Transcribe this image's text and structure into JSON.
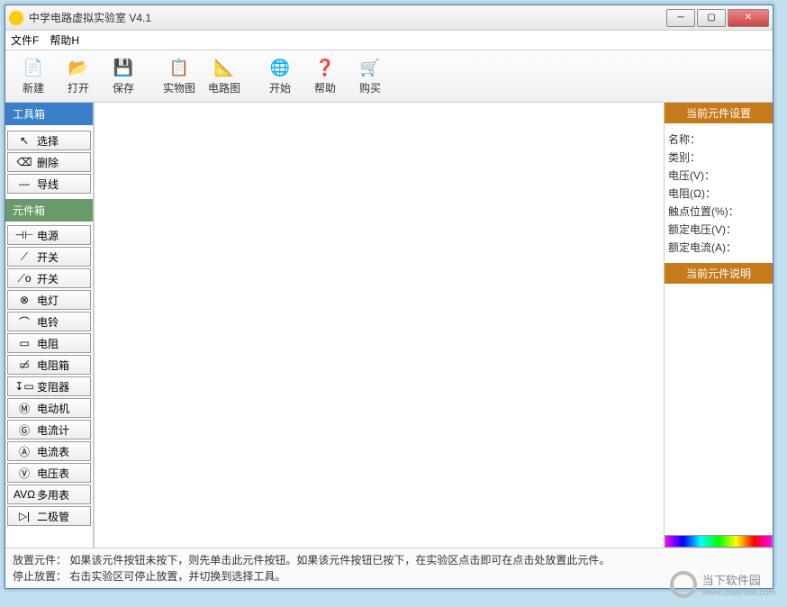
{
  "window": {
    "title": "中学电路虚拟实验室 V4.1"
  },
  "menubar": {
    "file": "文件F",
    "help": "帮助H"
  },
  "toolbar": {
    "items": [
      {
        "icon": "📄",
        "label": "新建",
        "name": "new"
      },
      {
        "icon": "📂",
        "label": "打开",
        "name": "open"
      },
      {
        "icon": "💾",
        "label": "保存",
        "name": "save"
      },
      {
        "icon": "📋",
        "label": "实物图",
        "name": "physical-view"
      },
      {
        "icon": "📐",
        "label": "电路图",
        "name": "circuit-view"
      },
      {
        "icon": "🌐",
        "label": "开始",
        "name": "start"
      },
      {
        "icon": "❓",
        "label": "帮助",
        "name": "help"
      },
      {
        "icon": "🛒",
        "label": "购买",
        "name": "buy"
      }
    ]
  },
  "toolbox": {
    "header": "工具箱",
    "items": [
      {
        "icon": "↖",
        "label": "选择",
        "name": "select-tool"
      },
      {
        "icon": "⌫",
        "label": "删除",
        "name": "delete-tool",
        "iconSvg": "eraser"
      },
      {
        "icon": "—",
        "label": "导线",
        "name": "wire-tool"
      }
    ]
  },
  "componentbox": {
    "header": "元件箱",
    "items": [
      {
        "icon": "⊣⊢",
        "label": "电源",
        "name": "power"
      },
      {
        "icon": "⟋",
        "label": "开关",
        "name": "switch-1"
      },
      {
        "icon": "⟋о",
        "label": "开关",
        "name": "switch-2"
      },
      {
        "icon": "⊗",
        "label": "电灯",
        "name": "lamp"
      },
      {
        "icon": "⌒",
        "label": "电铃",
        "name": "bell"
      },
      {
        "icon": "▭",
        "label": "电阻",
        "name": "resistor"
      },
      {
        "icon": "▭̸",
        "label": "电阻箱",
        "name": "resistor-box"
      },
      {
        "icon": "↧▭",
        "label": "变阻器",
        "name": "rheostat"
      },
      {
        "icon": "Ⓜ",
        "label": "电动机",
        "name": "motor"
      },
      {
        "icon": "Ⓖ",
        "label": "电流计",
        "name": "galvanometer"
      },
      {
        "icon": "Ⓐ",
        "label": "电流表",
        "name": "ammeter"
      },
      {
        "icon": "Ⓥ",
        "label": "电压表",
        "name": "voltmeter"
      },
      {
        "icon": "AVΩ",
        "label": "多用表",
        "name": "multimeter"
      },
      {
        "icon": "▷|",
        "label": "二极管",
        "name": "diode"
      }
    ]
  },
  "properties": {
    "header": "当前元件设置",
    "rows": [
      {
        "label": "名称："
      },
      {
        "label": "类别："
      },
      {
        "label": "电压(V)："
      },
      {
        "label": "电阻(Ω)："
      },
      {
        "label": "触点位置(%)："
      },
      {
        "label": "额定电压(V)："
      },
      {
        "label": "额定电流(A)："
      }
    ],
    "descHeader": "当前元件说明"
  },
  "statusbar": {
    "line1": "放置元件：   如果该元件按钮未按下，则先单击此元件按钮。如果该元件按钮已按下，在实验区点击即可在点击处放置此元件。",
    "line2": "停止放置：   右击实验区可停止放置，并切换到选择工具。"
  },
  "watermark": {
    "text": "当下软件园",
    "url": "www.downxia.com"
  }
}
